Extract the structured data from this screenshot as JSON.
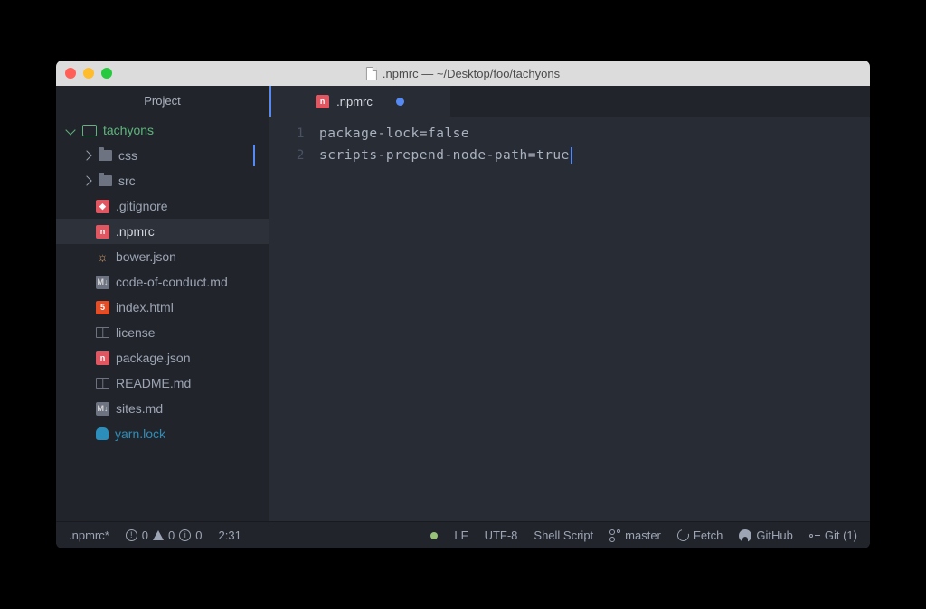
{
  "window": {
    "title": ".npmrc — ~/Desktop/foo/tachyons"
  },
  "sidebar": {
    "header": "Project",
    "root": "tachyons",
    "folders": [
      {
        "name": "css"
      },
      {
        "name": "src"
      }
    ],
    "files": [
      {
        "name": ".gitignore",
        "icon": "git"
      },
      {
        "name": ".npmrc",
        "icon": "npm",
        "selected": true
      },
      {
        "name": "bower.json",
        "icon": "bower"
      },
      {
        "name": "code-of-conduct.md",
        "icon": "md"
      },
      {
        "name": "index.html",
        "icon": "html"
      },
      {
        "name": "license",
        "icon": "book"
      },
      {
        "name": "package.json",
        "icon": "npm"
      },
      {
        "name": "README.md",
        "icon": "book"
      },
      {
        "name": "sites.md",
        "icon": "md"
      },
      {
        "name": "yarn.lock",
        "icon": "yarn"
      }
    ]
  },
  "tab": {
    "name": ".npmrc",
    "modified": true
  },
  "editor": {
    "lines": [
      "package-lock=false",
      "scripts-prepend-node-path=true"
    ]
  },
  "statusbar": {
    "filename": ".npmrc*",
    "err": "0",
    "warn": "0",
    "info": "0",
    "cursor": "2:31",
    "eol": "LF",
    "encoding": "UTF-8",
    "grammar": "Shell Script",
    "branch": "master",
    "fetch": "Fetch",
    "github": "GitHub",
    "git": "Git (1)"
  }
}
